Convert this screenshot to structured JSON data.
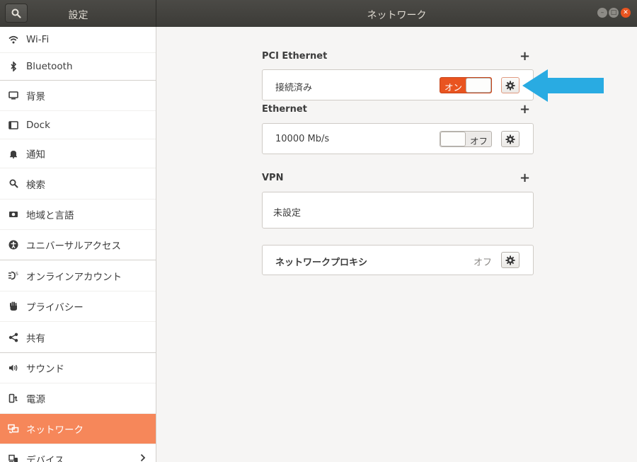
{
  "header": {
    "left_title": "設定",
    "title": "ネットワーク"
  },
  "sidebar": {
    "items": [
      {
        "label": "Wi-Fi",
        "icon": "wifi-icon"
      },
      {
        "label": "Bluetooth",
        "icon": "bluetooth-icon"
      },
      {
        "label": "背景",
        "icon": "background-icon"
      },
      {
        "label": "Dock",
        "icon": "dock-icon"
      },
      {
        "label": "通知",
        "icon": "bell-icon"
      },
      {
        "label": "検索",
        "icon": "search-icon"
      },
      {
        "label": "地域と言語",
        "icon": "region-icon"
      },
      {
        "label": "ユニバーサルアクセス",
        "icon": "accessibility-icon"
      },
      {
        "label": "オンラインアカウント",
        "icon": "online-accounts-icon"
      },
      {
        "label": "プライバシー",
        "icon": "hand-icon"
      },
      {
        "label": "共有",
        "icon": "share-icon"
      },
      {
        "label": "サウンド",
        "icon": "speaker-icon"
      },
      {
        "label": "電源",
        "icon": "power-icon"
      },
      {
        "label": "ネットワーク",
        "icon": "network-icon"
      },
      {
        "label": "デバイス",
        "icon": "devices-icon"
      }
    ],
    "active_index": 13
  },
  "pci": {
    "title": "PCI Ethernet",
    "status": "接続済み",
    "switch_label": "オン"
  },
  "ethernet": {
    "title": "Ethernet",
    "speed": "10000 Mb/s",
    "switch_label": "オフ"
  },
  "vpn": {
    "title": "VPN",
    "status": "未設定"
  },
  "proxy": {
    "label": "ネットワークプロキシ",
    "status": "オフ"
  },
  "colors": {
    "accent": "#e95420",
    "active_sidebar": "#f6875a",
    "arrow": "#29abe2"
  }
}
